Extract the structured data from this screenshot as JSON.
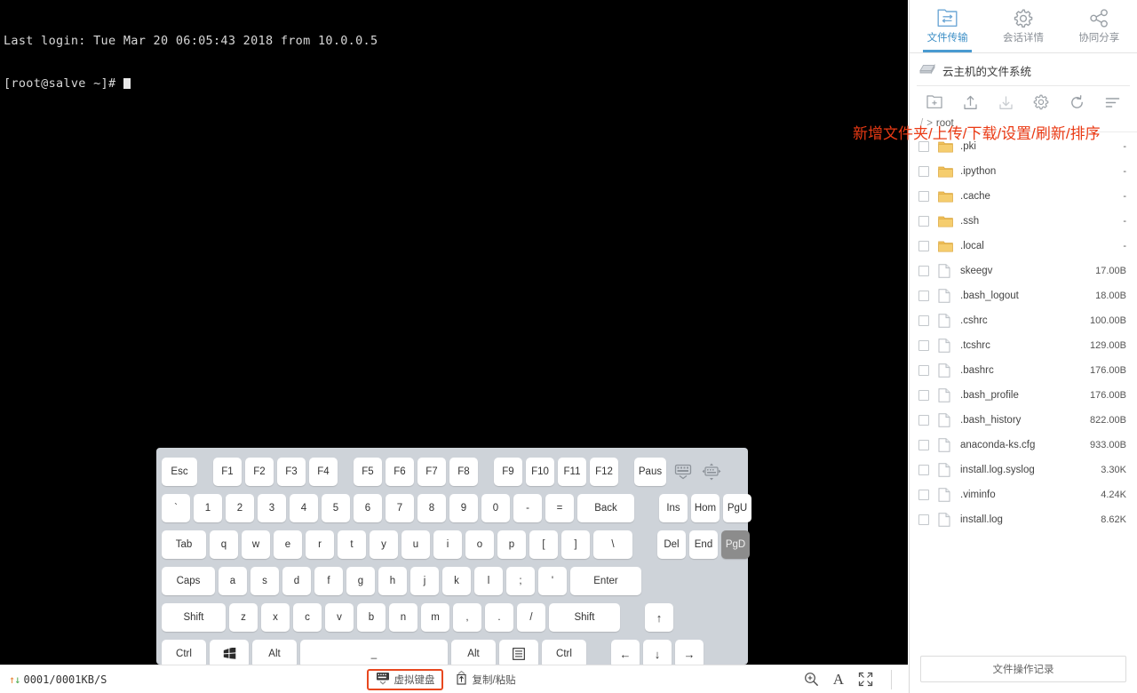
{
  "terminal": {
    "line1": "Last login: Tue Mar 20 06:05:43 2018 from 10.0.0.5",
    "line2": "[root@salve ~]# "
  },
  "keyboard": {
    "row_fn": [
      "Esc",
      "F1",
      "F2",
      "F3",
      "F4",
      "F5",
      "F6",
      "F7",
      "F8",
      "F9",
      "F10",
      "F11",
      "F12",
      "Paus"
    ],
    "row_num": [
      "`",
      "1",
      "2",
      "3",
      "4",
      "5",
      "6",
      "7",
      "8",
      "9",
      "0",
      "-",
      "=",
      "Back"
    ],
    "row_num_nav": [
      "Ins",
      "Hom",
      "PgU"
    ],
    "row_q": [
      "Tab",
      "q",
      "w",
      "e",
      "r",
      "t",
      "y",
      "u",
      "i",
      "o",
      "p",
      "[",
      "]",
      "\\"
    ],
    "row_q_nav": [
      "Del",
      "End",
      "PgD"
    ],
    "row_a": [
      "Caps",
      "a",
      "s",
      "d",
      "f",
      "g",
      "h",
      "j",
      "k",
      "l",
      ";",
      "'",
      "Enter"
    ],
    "row_z": [
      "Shift",
      "z",
      "x",
      "c",
      "v",
      "b",
      "n",
      "m",
      ",",
      ".",
      "/",
      "Shift"
    ],
    "row_ctrl": [
      "Ctrl",
      "Win",
      "Alt",
      "_",
      "Alt",
      "Menu",
      "Ctrl"
    ],
    "arrows": {
      "up": "↑",
      "left": "←",
      "down": "↓",
      "right": "→"
    },
    "pressed_key": "PgD",
    "collapse_icon": "keyboard-collapse-icon",
    "move_icon": "keyboard-move-icon"
  },
  "statusbar": {
    "speed": "0001/0001KB/S",
    "speed_up_arrow": "↑",
    "speed_down_arrow": "↓",
    "virtual_keyboard_label": "虚拟键盘",
    "copy_paste_label": "复制/粘贴",
    "zoom_icon": "magnifier-zoom-icon",
    "font_icon": "A",
    "fullscreen_icon": "fullscreen-icon"
  },
  "panel": {
    "tabs": [
      {
        "label": "文件传输",
        "icon": "file-transfer-icon",
        "active": true
      },
      {
        "label": "会话详情",
        "icon": "gear-icon",
        "active": false
      },
      {
        "label": "协同分享",
        "icon": "share-icon",
        "active": false
      }
    ],
    "filesystem_title": "云主机的文件系统",
    "filesystem_icon": "disk-drive-icon",
    "toolbar": [
      {
        "name": "new-folder-icon",
        "label": "新增文件夹",
        "disabled": false
      },
      {
        "name": "upload-icon",
        "label": "上传",
        "disabled": false
      },
      {
        "name": "download-icon",
        "label": "下载",
        "disabled": true
      },
      {
        "name": "gear-icon",
        "label": "设置",
        "disabled": false
      },
      {
        "name": "refresh-icon",
        "label": "刷新",
        "disabled": false
      },
      {
        "name": "sort-icon",
        "label": "排序",
        "disabled": false
      }
    ],
    "annotation": "新增文件夹/上传/下载/设置/刷新/排序",
    "annotation_color": "#ea3a14",
    "breadcrumb": {
      "root": "/",
      "separator": ">",
      "current": "root"
    },
    "files": [
      {
        "name": ".pki",
        "size": "-",
        "type": "folder"
      },
      {
        "name": ".ipython",
        "size": "-",
        "type": "folder"
      },
      {
        "name": ".cache",
        "size": "-",
        "type": "folder"
      },
      {
        "name": ".ssh",
        "size": "-",
        "type": "folder"
      },
      {
        "name": ".local",
        "size": "-",
        "type": "folder"
      },
      {
        "name": "skeegv",
        "size": "17.00B",
        "type": "file"
      },
      {
        "name": ".bash_logout",
        "size": "18.00B",
        "type": "file"
      },
      {
        "name": ".cshrc",
        "size": "100.00B",
        "type": "file"
      },
      {
        "name": ".tcshrc",
        "size": "129.00B",
        "type": "file"
      },
      {
        "name": ".bashrc",
        "size": "176.00B",
        "type": "file"
      },
      {
        "name": ".bash_profile",
        "size": "176.00B",
        "type": "file"
      },
      {
        "name": ".bash_history",
        "size": "822.00B",
        "type": "file"
      },
      {
        "name": "anaconda-ks.cfg",
        "size": "933.00B",
        "type": "file"
      },
      {
        "name": "install.log.syslog",
        "size": "3.30K",
        "type": "file"
      },
      {
        "name": ".viminfo",
        "size": "4.24K",
        "type": "file"
      },
      {
        "name": "install.log",
        "size": "8.62K",
        "type": "file"
      }
    ],
    "oplog_label": "文件操作记录"
  },
  "colors": {
    "accent": "#4a9bd1",
    "annotation": "#ea3a14",
    "terminal_bg": "#000000",
    "folder": "#f0c05a",
    "keyboard_bg": "#ced3d9"
  }
}
